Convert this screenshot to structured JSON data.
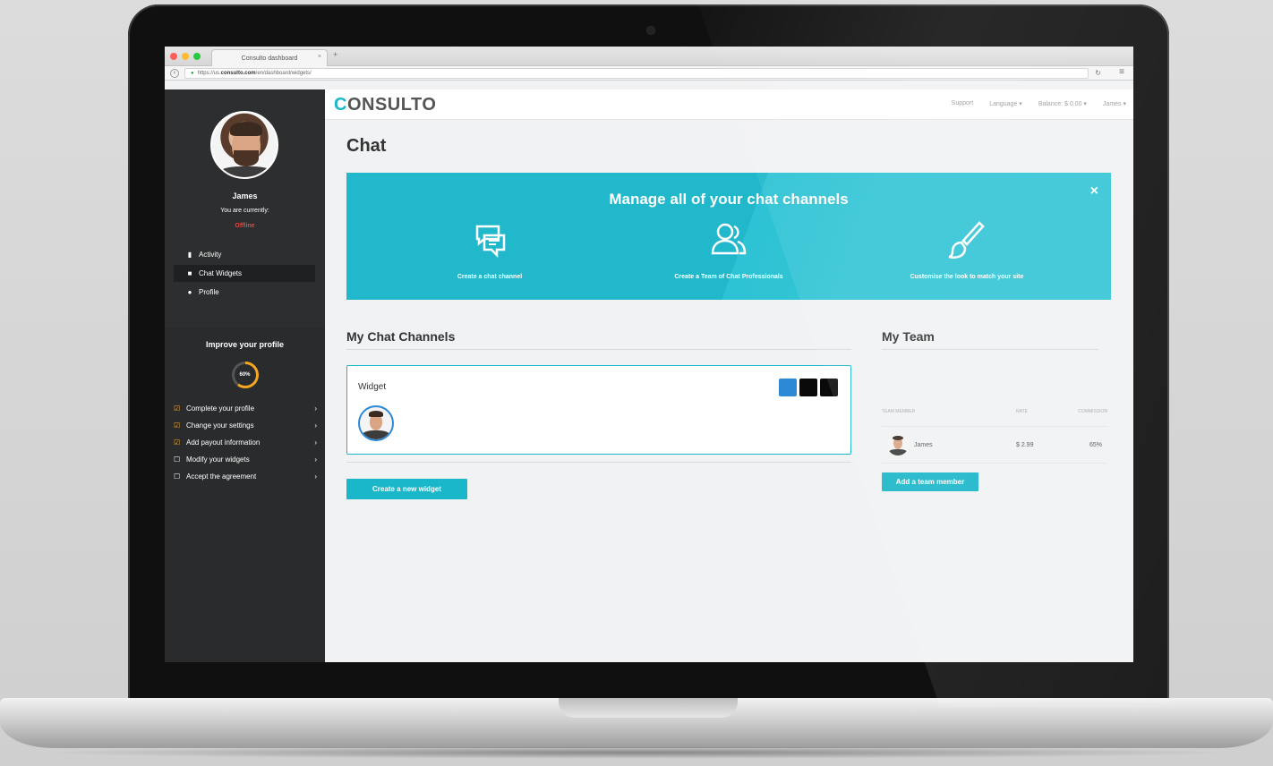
{
  "browser": {
    "tab_title": "Consulto dashboard",
    "url_prefix": "https://us.",
    "url_domain": "consulto.com",
    "url_path": "/en/dashboard/widgets/"
  },
  "sidebar": {
    "name": "James",
    "status_label": "You are currently:",
    "status": "Offline",
    "nav": [
      {
        "label": "Activity",
        "icon": "bar-chart-icon"
      },
      {
        "label": "Chat Widgets",
        "icon": "chat-icon",
        "active": true
      },
      {
        "label": "Profile",
        "icon": "user-icon"
      }
    ],
    "improve_title": "Improve your profile",
    "progress": 60,
    "progress_label": "60%",
    "checklist": [
      {
        "label": "Complete your profile",
        "done": true
      },
      {
        "label": "Change your settings",
        "done": true
      },
      {
        "label": "Add payout information",
        "done": true
      },
      {
        "label": "Modify your widgets",
        "done": false
      },
      {
        "label": "Accept the agreement",
        "done": false
      }
    ]
  },
  "topbar": {
    "brand_first": "C",
    "brand_rest": "ONSULTO",
    "support": "Support",
    "language": "Language ▾",
    "balance": "Balance: $ 0.00 ▾",
    "user": "James ▾"
  },
  "page": {
    "title": "Chat"
  },
  "banner": {
    "title": "Manage all of your chat channels",
    "close": "×",
    "features": [
      {
        "label": "Create a chat channel",
        "icon": "chat-bubbles-icon"
      },
      {
        "label": "Create a Team of Chat Professionals",
        "icon": "team-icon"
      },
      {
        "label": "Customise the look to match your site",
        "icon": "brush-icon"
      }
    ]
  },
  "channels": {
    "title": "My Chat Channels",
    "widget_name": "Widget",
    "swatch_colors": [
      "#2c89d6",
      "#0a0a0a",
      "#0a0a0a"
    ],
    "create_button": "Create a new widget"
  },
  "team": {
    "title": "My Team",
    "columns": [
      "TEAM MEMBER",
      "RATE",
      "COMMISSION"
    ],
    "rows": [
      {
        "name": "James",
        "rate": "$ 2.99",
        "commission": "65%"
      }
    ],
    "add_button": "Add a team member"
  }
}
